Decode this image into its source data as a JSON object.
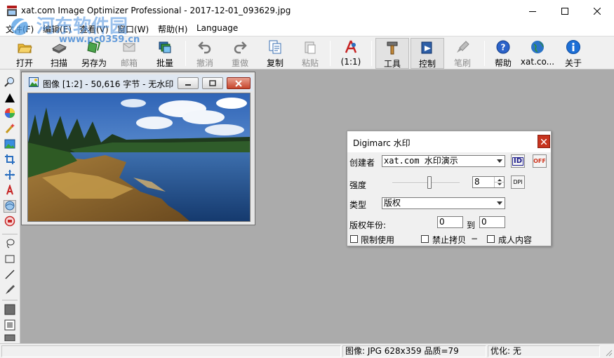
{
  "window": {
    "title": "xat.com  Image Optimizer Professional - 2017-12-01_093629.jpg",
    "watermark_text": "河东软件园",
    "watermark_url": "www.pc0359.cn"
  },
  "menu": [
    "文件(F)",
    "编辑(E)",
    "查看(V)",
    "窗口(W)",
    "帮助(H)",
    "Language"
  ],
  "toolbar": [
    {
      "label": "打开",
      "icon": "open-folder-icon",
      "disabled": false
    },
    {
      "label": "扫描",
      "icon": "scanner-icon",
      "disabled": false
    },
    {
      "label": "另存为",
      "icon": "save-as-icon",
      "disabled": false
    },
    {
      "label": "邮箱",
      "icon": "mail-icon",
      "disabled": true
    },
    {
      "label": "批量",
      "icon": "batch-icon",
      "disabled": false
    },
    {
      "label": "撤消",
      "icon": "undo-icon",
      "disabled": true
    },
    {
      "label": "重做",
      "icon": "redo-icon",
      "disabled": true
    },
    {
      "label": "复制",
      "icon": "copy-icon",
      "disabled": false
    },
    {
      "label": "粘贴",
      "icon": "paste-icon",
      "disabled": true
    },
    {
      "label": "(1:1)",
      "icon": "actual-size-icon",
      "disabled": false
    },
    {
      "label": "工具",
      "icon": "hammer-icon",
      "disabled": false,
      "pressed": true
    },
    {
      "label": "控制",
      "icon": "control-panel-icon",
      "disabled": false,
      "pressed": true
    },
    {
      "label": "笔刷",
      "icon": "brush-icon",
      "disabled": true
    },
    {
      "label": "帮助",
      "icon": "help-icon",
      "disabled": false
    },
    {
      "label": "xat.co...",
      "icon": "globe-icon",
      "disabled": false
    },
    {
      "label": "关于",
      "icon": "info-icon",
      "disabled": false
    }
  ],
  "image_window": {
    "title": "图像  [1:2] - 50,616 字节  - 无水印"
  },
  "dialog": {
    "title": "Digimarc 水印",
    "creator_label": "创建者",
    "creator_value": "xat.com 水印演示",
    "id_button": "ID",
    "off_button": "OFF",
    "strength_label": "强度",
    "strength_value": "8",
    "slider_level": 0.55,
    "dpi_button": "DPI",
    "type_label": "类型",
    "type_value": "版权",
    "year_label": "版权年份:",
    "year_from": "0",
    "year_to_label": "到",
    "year_to": "0",
    "restrict_label": "限制使用",
    "nocopy_label": "禁止拷贝",
    "adult_label": "成人内容"
  },
  "status": {
    "image_info": "图像: JPG 628x359  品质=79",
    "optimize": "优化: 无"
  }
}
